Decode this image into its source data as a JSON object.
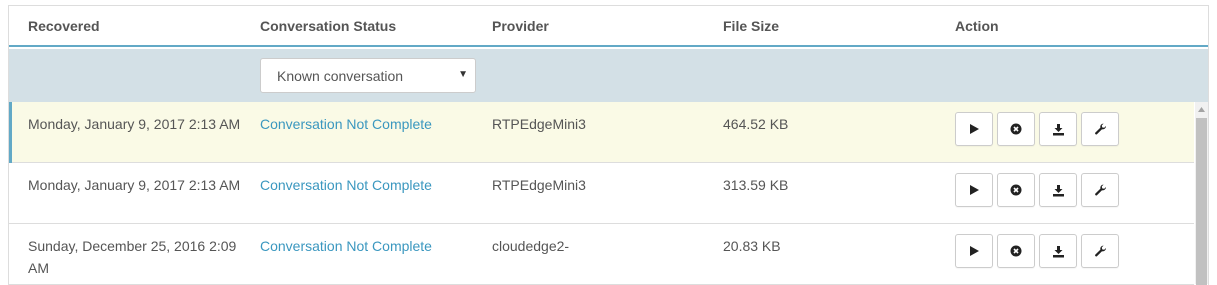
{
  "table": {
    "headers": {
      "recovered": "Recovered",
      "status": "Conversation Status",
      "provider": "Provider",
      "file_size": "File Size",
      "action": "Action"
    },
    "filter": {
      "status_select_value": "Known conversation"
    },
    "rows": [
      {
        "recovered": "Monday, January 9, 2017 2:13 AM",
        "status": "Conversation Not Complete",
        "provider": "RTPEdgeMini3",
        "file_size": "464.52 KB",
        "selected": true
      },
      {
        "recovered": "Monday, January 9, 2017 2:13 AM",
        "status": "Conversation Not Complete",
        "provider": "RTPEdgeMini3",
        "file_size": "313.59 KB",
        "selected": false
      },
      {
        "recovered": "Sunday, December 25, 2016 2:09 AM",
        "status": "Conversation Not Complete",
        "provider": "cloudedge2-",
        "file_size": "20.83 KB",
        "selected": false
      }
    ],
    "action_icons": [
      "play-icon",
      "cancel-icon",
      "download-icon",
      "wrench-icon"
    ]
  },
  "colors": {
    "accent": "#62a9c6",
    "link": "#3a97bf",
    "filter_row_bg": "#d3e0e6",
    "selected_row_bg": "#fafae6"
  }
}
